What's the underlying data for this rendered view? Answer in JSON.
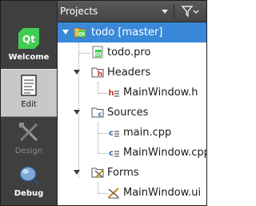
{
  "sidebar": {
    "modes": [
      {
        "label": "Welcome",
        "icon": "qt-logo-icon",
        "state": "normal"
      },
      {
        "label": "Edit",
        "icon": "document-edit-icon",
        "state": "active"
      },
      {
        "label": "Design",
        "icon": "design-pencil-icon",
        "state": "disabled"
      },
      {
        "label": "Debug",
        "icon": "debug-bug-icon",
        "state": "normal"
      }
    ]
  },
  "projects_pane": {
    "title": "Projects",
    "filter_icon": "filter-funnel-icon",
    "dropdown_icon": "chevron-down-icon"
  },
  "tree": {
    "root": {
      "label": "todo [master]",
      "icon": "qt-project-icon",
      "selected": true
    },
    "project_file": {
      "label": "todo.pro",
      "icon": "pro-file-icon"
    },
    "headers": {
      "label": "Headers",
      "icon": "headers-folder-icon",
      "children": [
        {
          "label": "MainWindow.h",
          "icon": "header-file-icon"
        }
      ]
    },
    "sources": {
      "label": "Sources",
      "icon": "sources-folder-icon",
      "children": [
        {
          "label": "main.cpp",
          "icon": "cpp-file-icon"
        },
        {
          "label": "MainWindow.cpp",
          "icon": "cpp-file-icon"
        }
      ]
    },
    "forms": {
      "label": "Forms",
      "icon": "forms-folder-icon",
      "children": [
        {
          "label": "MainWindow.ui",
          "icon": "ui-file-icon"
        }
      ]
    }
  },
  "colors": {
    "selection": "#3a88d8",
    "sidebar_bg": "#3f3f3f",
    "qt_green": "#41cd52"
  }
}
